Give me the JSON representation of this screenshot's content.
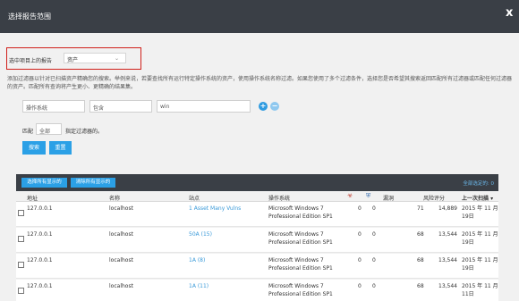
{
  "dialog": {
    "title": "选择报告范围",
    "close": "x"
  },
  "scope": {
    "label": "选中项目上的报告",
    "value": "资产",
    "chevron": "⌄"
  },
  "description": "添加过滤器以针对已扫描资产精确您的搜索。举例来说，若要查找所有运行特定操作系统的资产，使用操作系统名称过滤。如果您使用了多个过滤条件，选择您是否希望其搜索返回匹配所有过滤器或匹配任何过滤器的资产。匹配所有查询将产生更小、更精确的结果集。",
  "filters": {
    "field1": "操作系统",
    "field2": "包含",
    "field3": "win"
  },
  "match": {
    "label": "匹配",
    "value": "全部",
    "after": "指定过滤器的。"
  },
  "buttons": {
    "search": "搜索",
    "reset": "重置"
  },
  "table_toolbar": {
    "select_visible": "选择所有显示的",
    "clear_visible": "清除所有显示的",
    "selected_total": "全部选定的: 0"
  },
  "table": {
    "headers": {
      "address": "地址",
      "name": "名称",
      "site": "站点",
      "os": "操作系统",
      "hazard_icon": "biohazard-icon",
      "shield_icon": "shield-icon",
      "vulns": "漏洞",
      "risk": "风险评分",
      "last_scan": "上一次扫描 ▾"
    },
    "rows": [
      {
        "address": "127.0.0.1",
        "name": "localhost",
        "site": "1 Asset Many Vulns",
        "os1": "Microsoft Windows 7",
        "os2": "Professional Edition SP1",
        "malware": "0",
        "exploits": "0",
        "vulns": "71",
        "risk": "14,889",
        "date1": "2015 年 11 月",
        "date2": "19日"
      },
      {
        "address": "127.0.0.1",
        "name": "localhost",
        "site": "50A (15)",
        "os1": "Microsoft Windows 7",
        "os2": "Professional Edition SP1",
        "malware": "0",
        "exploits": "0",
        "vulns": "68",
        "risk": "13,544",
        "date1": "2015 年 11 月",
        "date2": "19日"
      },
      {
        "address": "127.0.0.1",
        "name": "localhost",
        "site": "1A (8)",
        "os1": "Microsoft Windows 7",
        "os2": "Professional Edition SP1",
        "malware": "0",
        "exploits": "0",
        "vulns": "68",
        "risk": "13,544",
        "date1": "2015 年 11 月",
        "date2": "19日"
      },
      {
        "address": "127.0.0.1",
        "name": "localhost",
        "site": "1A (11)",
        "os1": "Microsoft Windows 7",
        "os2": "Professional Edition SP1",
        "malware": "0",
        "exploits": "0",
        "vulns": "68",
        "risk": "13,544",
        "date1": "2015 年 11 月",
        "date2": "11日"
      }
    ]
  }
}
